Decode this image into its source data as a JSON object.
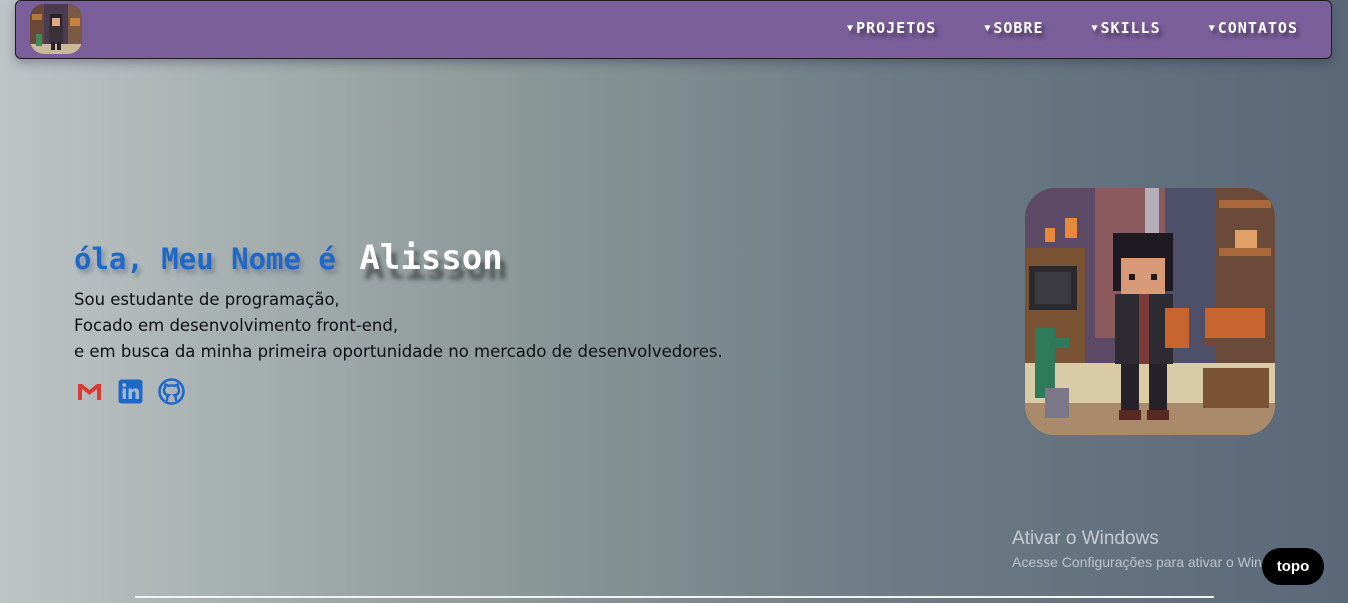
{
  "nav": {
    "items": [
      {
        "label": "PROJETOS"
      },
      {
        "label": "SOBRE"
      },
      {
        "label": "SKILLS"
      },
      {
        "label": "CONTATOS"
      }
    ],
    "caret": "▼"
  },
  "hero": {
    "greeting": "óla, Meu Nome é",
    "name": "Alisson",
    "lines": [
      "Sou estudante de programação,",
      "Focado em desenvolvimento front-end,",
      "e em busca da minha primeira oportunidade no mercado de desenvolvedores."
    ]
  },
  "socials": [
    {
      "icon": "gmail-icon",
      "color": "#d93a32"
    },
    {
      "icon": "linkedin-icon",
      "color": "#1d68c9"
    },
    {
      "icon": "github-icon",
      "color": "#1d68c9"
    }
  ],
  "watermark": {
    "title": "Ativar o Windows",
    "subtitle": "Acesse Configurações para ativar o Windows."
  },
  "top_button": {
    "label": "topo"
  },
  "colors": {
    "navbar": "#7b5f9b",
    "accent_blue": "#1d68c9"
  }
}
